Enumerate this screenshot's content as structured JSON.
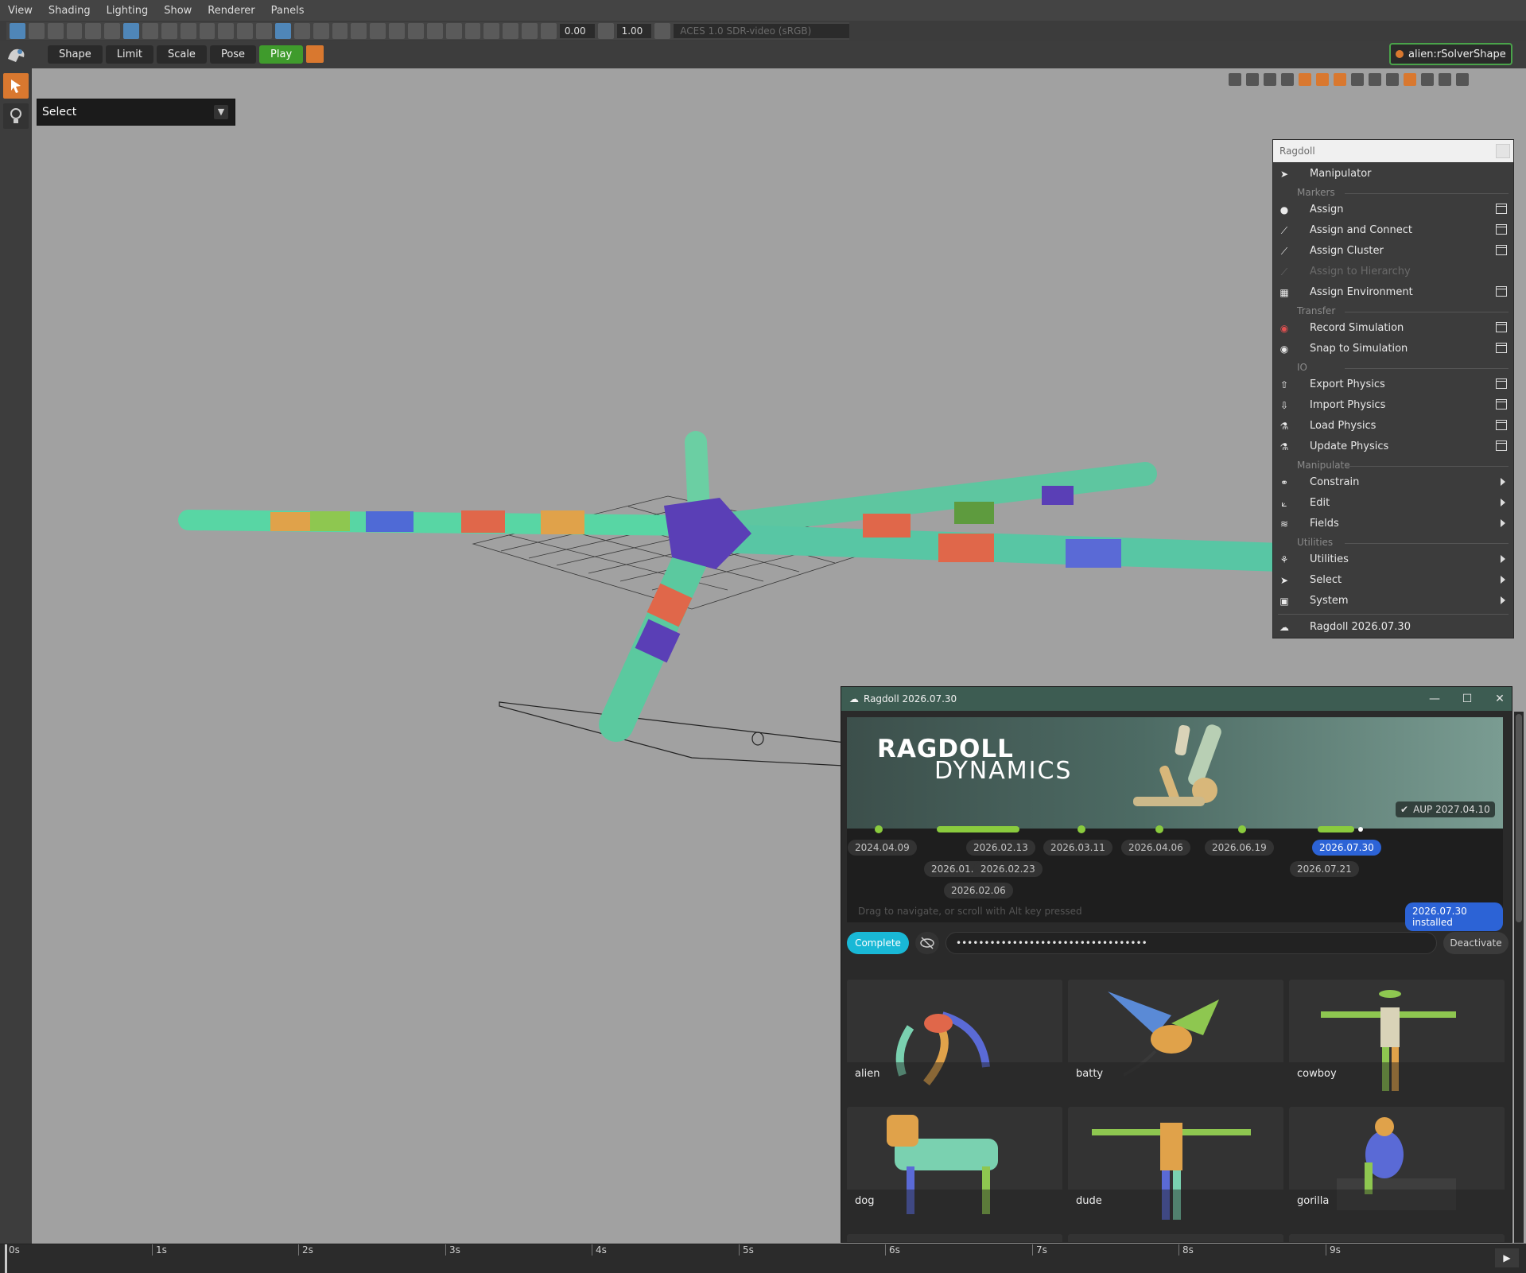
{
  "menubar": {
    "items": [
      "View",
      "Shading",
      "Lighting",
      "Show",
      "Renderer",
      "Panels"
    ]
  },
  "viewport_toolbar": {
    "exposure": "0.00",
    "gamma": "1.00",
    "color_space": "ACES 1.0 SDR-video (sRGB)"
  },
  "shelf": {
    "tabs": [
      "Shape",
      "Limit",
      "Scale",
      "Pose",
      "Play"
    ],
    "solver_label": "alien:rSolverShape"
  },
  "select_dropdown": {
    "value": "Select"
  },
  "ragdoll_menu": {
    "title": "Ragdoll",
    "manipulator": "Manipulator",
    "sections": {
      "markers": "Markers",
      "transfer": "Transfer",
      "io": "IO",
      "manipulate": "Manipulate",
      "utilities": "Utilities"
    },
    "items": {
      "assign": "Assign",
      "assign_connect": "Assign and Connect",
      "assign_cluster": "Assign Cluster",
      "assign_hierarchy": "Assign to Hierarchy",
      "assign_environment": "Assign Environment",
      "record_simulation": "Record Simulation",
      "snap_simulation": "Snap to Simulation",
      "export_physics": "Export Physics",
      "import_physics": "Import Physics",
      "load_physics": "Load Physics",
      "update_physics": "Update Physics",
      "constrain": "Constrain",
      "edit": "Edit",
      "fields": "Fields",
      "utilities": "Utilities",
      "select": "Select",
      "system": "System",
      "version": "Ragdoll 2026.07.30"
    }
  },
  "ragdoll_window": {
    "title": "Ragdoll 2026.07.30",
    "brand_line1": "RAGDOLL",
    "brand_line2": "DYNAMICS",
    "aup": "AUP  2027.04.10",
    "versions": {
      "v1": "2024.04.09",
      "v2": "2026.01.30",
      "v3": "2026.02.06",
      "v4": "2026.02.13",
      "v5": "2026.02.23",
      "v6": "2026.03.11",
      "v7": "2026.04.06",
      "v8": "2026.06.19",
      "v9": "2026.07.21",
      "v10": "2026.07.30"
    },
    "drag_hint": "Drag to navigate, or scroll with Alt key pressed",
    "installed": "2026.07.30 installed",
    "complete_label": "Complete",
    "license_key": "••••••••••••••••••••••••••••••••••",
    "deactivate_label": "Deactivate",
    "assets": [
      "alien",
      "batty",
      "cowboy",
      "dog",
      "dude",
      "gorilla"
    ]
  },
  "time_slider": {
    "ticks": [
      "0s",
      "1s",
      "2s",
      "3s",
      "4s",
      "5s",
      "6s",
      "7s",
      "8s",
      "9s"
    ]
  },
  "colors": {
    "accent_orange": "#d9782f",
    "play_green": "#3f9b2c",
    "selected_blue": "#2c63d6",
    "timeline_green": "#8acb3e",
    "complete_cyan": "#19b8d6"
  }
}
